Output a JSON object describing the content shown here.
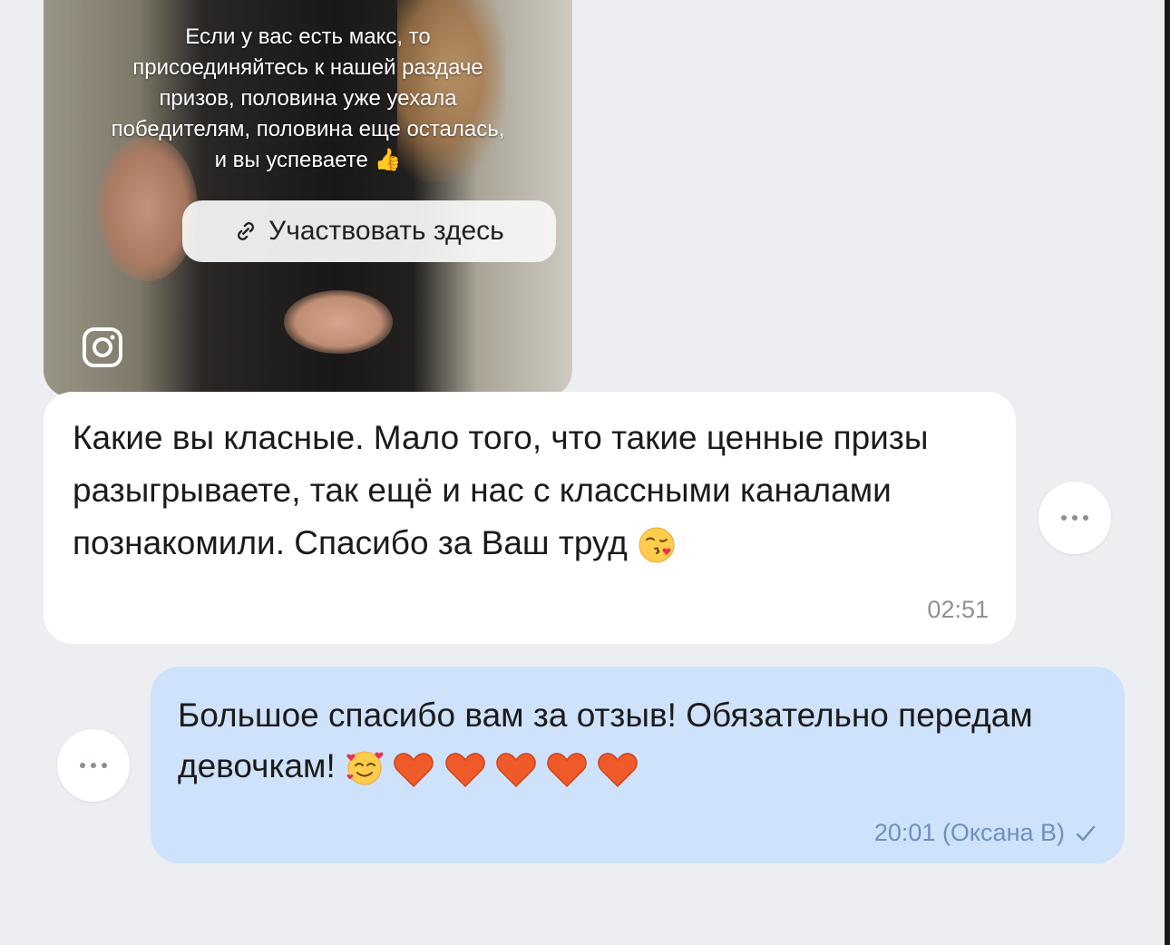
{
  "media": {
    "caption_lines": [
      "Если у вас есть макс, то",
      "присоединяйтесь к нашей раздаче",
      "призов, половина уже уехала",
      "победителям, половина еще осталась,",
      "и вы успеваете 👍"
    ],
    "participate_label": "Участвовать здесь",
    "source_icon": "instagram-icon"
  },
  "incoming_message": {
    "text": "Какие вы класные. Мало того, что такие ценные призы разыгрываете, так ещё и нас с классными каналами познакомили. Спасибо за Ваш труд",
    "emoji": "face-blowing-kiss",
    "time": "02:51"
  },
  "outgoing_message": {
    "text": "Большое спасибо вам за отзыв! Обязательно передам девочкам!",
    "emoji": [
      "smiling-face-with-hearts",
      "heart",
      "heart",
      "heart",
      "heart",
      "heart"
    ],
    "time_author": "20:01 (Оксана В)",
    "status_icon": "check-icon"
  },
  "colors": {
    "background": "#eceef1",
    "incoming_bubble": "#ffffff",
    "outgoing_bubble": "#cfe2fb",
    "meta_text": "#6f8fbd",
    "heart": "#f05a28"
  }
}
